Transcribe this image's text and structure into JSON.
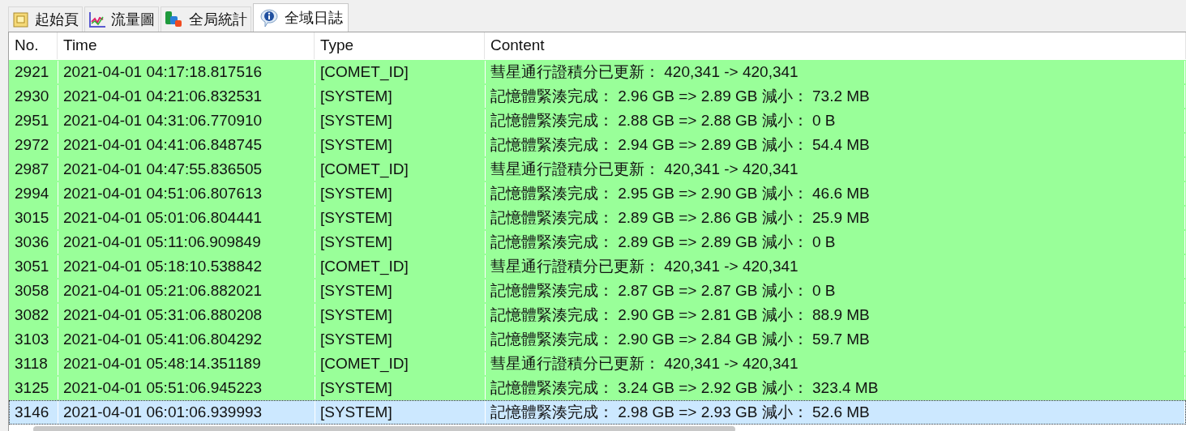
{
  "tabs": [
    {
      "label": "起始頁",
      "kind": "home",
      "selected": false
    },
    {
      "label": "流量圖",
      "kind": "chart",
      "selected": false
    },
    {
      "label": "全局統計",
      "kind": "stats",
      "selected": false
    },
    {
      "label": "全域日誌",
      "kind": "info",
      "selected": true
    }
  ],
  "table": {
    "columns": [
      "No.",
      "Time",
      "Type",
      "Content"
    ],
    "rows": [
      {
        "no": "2921",
        "time": "2021-04-01 04:17:18.817516",
        "type": "[COMET_ID]",
        "content": "彗星通行證積分已更新： 420,341 -> 420,341",
        "selected": false
      },
      {
        "no": "2930",
        "time": "2021-04-01 04:21:06.832531",
        "type": "[SYSTEM]",
        "content": "記憶體緊湊完成： 2.96 GB => 2.89 GB 減小： 73.2 MB",
        "selected": false
      },
      {
        "no": "2951",
        "time": "2021-04-01 04:31:06.770910",
        "type": "[SYSTEM]",
        "content": "記憶體緊湊完成： 2.88 GB => 2.88 GB 減小： 0 B",
        "selected": false
      },
      {
        "no": "2972",
        "time": "2021-04-01 04:41:06.848745",
        "type": "[SYSTEM]",
        "content": "記憶體緊湊完成： 2.94 GB => 2.89 GB 減小： 54.4 MB",
        "selected": false
      },
      {
        "no": "2987",
        "time": "2021-04-01 04:47:55.836505",
        "type": "[COMET_ID]",
        "content": "彗星通行證積分已更新： 420,341 -> 420,341",
        "selected": false
      },
      {
        "no": "2994",
        "time": "2021-04-01 04:51:06.807613",
        "type": "[SYSTEM]",
        "content": "記憶體緊湊完成： 2.95 GB => 2.90 GB 減小： 46.6 MB",
        "selected": false
      },
      {
        "no": "3015",
        "time": "2021-04-01 05:01:06.804441",
        "type": "[SYSTEM]",
        "content": "記憶體緊湊完成： 2.89 GB => 2.86 GB 減小： 25.9 MB",
        "selected": false
      },
      {
        "no": "3036",
        "time": "2021-04-01 05:11:06.909849",
        "type": "[SYSTEM]",
        "content": "記憶體緊湊完成： 2.89 GB => 2.89 GB 減小： 0 B",
        "selected": false
      },
      {
        "no": "3051",
        "time": "2021-04-01 05:18:10.538842",
        "type": "[COMET_ID]",
        "content": "彗星通行證積分已更新： 420,341 -> 420,341",
        "selected": false
      },
      {
        "no": "3058",
        "time": "2021-04-01 05:21:06.882021",
        "type": "[SYSTEM]",
        "content": "記憶體緊湊完成： 2.87 GB => 2.87 GB 減小： 0 B",
        "selected": false
      },
      {
        "no": "3082",
        "time": "2021-04-01 05:31:06.880208",
        "type": "[SYSTEM]",
        "content": "記憶體緊湊完成： 2.90 GB => 2.81 GB 減小： 88.9 MB",
        "selected": false
      },
      {
        "no": "3103",
        "time": "2021-04-01 05:41:06.804292",
        "type": "[SYSTEM]",
        "content": "記憶體緊湊完成： 2.90 GB => 2.84 GB 減小： 59.7 MB",
        "selected": false
      },
      {
        "no": "3118",
        "time": "2021-04-01 05:48:14.351189",
        "type": "[COMET_ID]",
        "content": "彗星通行證積分已更新： 420,341 -> 420,341",
        "selected": false
      },
      {
        "no": "3125",
        "time": "2021-04-01 05:51:06.945223",
        "type": "[SYSTEM]",
        "content": "記憶體緊湊完成： 3.24 GB => 2.92 GB 減小： 323.4 MB",
        "selected": false
      },
      {
        "no": "3146",
        "time": "2021-04-01 06:01:06.939993",
        "type": "[SYSTEM]",
        "content": "記憶體緊湊完成： 2.98 GB => 2.93 GB 減小： 52.6 MB",
        "selected": true
      }
    ]
  }
}
